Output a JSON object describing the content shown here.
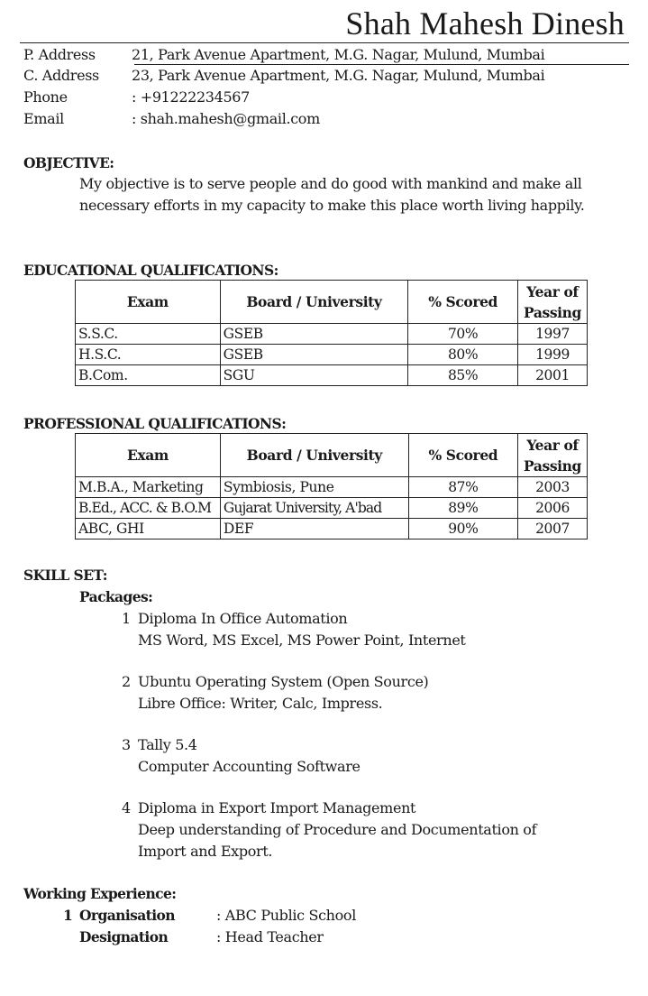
{
  "header": {
    "name": "Shah Mahesh Dinesh"
  },
  "contact": [
    {
      "label": "P. Address",
      "value": " 21, Park Avenue Apartment, M.G. Nagar, Mulund, Mumbai"
    },
    {
      "label": "C. Address",
      "value": " 23, Park Avenue Apartment, M.G. Nagar, Mulund, Mumbai"
    },
    {
      "label": "Phone",
      "value": ": +91222234567"
    },
    {
      "label": "Email",
      "value": ": shah.mahesh@gmail.com"
    }
  ],
  "objective": {
    "heading": "OBJECTIVE:",
    "lines": [
      "My objective is to serve people and do good with mankind and make all",
      "necessary efforts in my capacity to make this place worth living happily."
    ]
  },
  "education": {
    "heading": "EDUCATIONAL QUALIFICATIONS:",
    "columns": [
      "Exam",
      "Board / University",
      "% Scored",
      "Year of Passing"
    ],
    "columns_split": {
      "year_line1": "Year of",
      "year_line2": "Passing"
    },
    "rows": [
      {
        "exam": "S.S.C.",
        "board": "GSEB",
        "score": "70%",
        "year": "1997"
      },
      {
        "exam": "H.S.C.",
        "board": "GSEB",
        "score": "80%",
        "year": "1999"
      },
      {
        "exam": "B.Com.",
        "board": "SGU",
        "score": "85%",
        "year": "2001"
      }
    ]
  },
  "professional": {
    "heading": "PROFESSIONAL QUALIFICATIONS:",
    "columns": [
      "Exam",
      "Board / University",
      "% Scored",
      "Year of Passing"
    ],
    "columns_split": {
      "year_line1": "Year of",
      "year_line2": "Passing"
    },
    "rows": [
      {
        "exam": "M.B.A., Marketing",
        "board": "Symbiosis, Pune",
        "score": "87%",
        "year": "2003"
      },
      {
        "exam": "B.Ed., ACC. & B.O.M",
        "board": "Gujarat University, A'bad",
        "score": "89%",
        "year": "2006"
      },
      {
        "exam": "ABC, GHI",
        "board": "DEF",
        "score": "90%",
        "year": "2007"
      }
    ]
  },
  "skills": {
    "heading": "SKILL SET:",
    "subheading": "Packages:",
    "items": [
      {
        "num": "1",
        "title": "Diploma In Office Automation",
        "details": [
          "MS Word, MS Excel, MS Power Point, Internet"
        ]
      },
      {
        "num": "2",
        "title": "Ubuntu Operating System (Open Source)",
        "details": [
          "Libre Office: Writer, Calc, Impress."
        ]
      },
      {
        "num": "3",
        "title": "Tally 5.4",
        "details": [
          "Computer Accounting Software"
        ]
      },
      {
        "num": "4",
        "title": "Diploma in Export Import Management",
        "details": [
          "Deep understanding of Procedure and Documentation of",
          "Import and Export."
        ]
      }
    ]
  },
  "experience": {
    "heading": "Working Experience:",
    "entries": [
      {
        "num": "1",
        "org_label": "Organisation",
        "org_value": ": ABC Public School",
        "des_label": "Designation",
        "des_value": ": Head Teacher"
      }
    ]
  }
}
